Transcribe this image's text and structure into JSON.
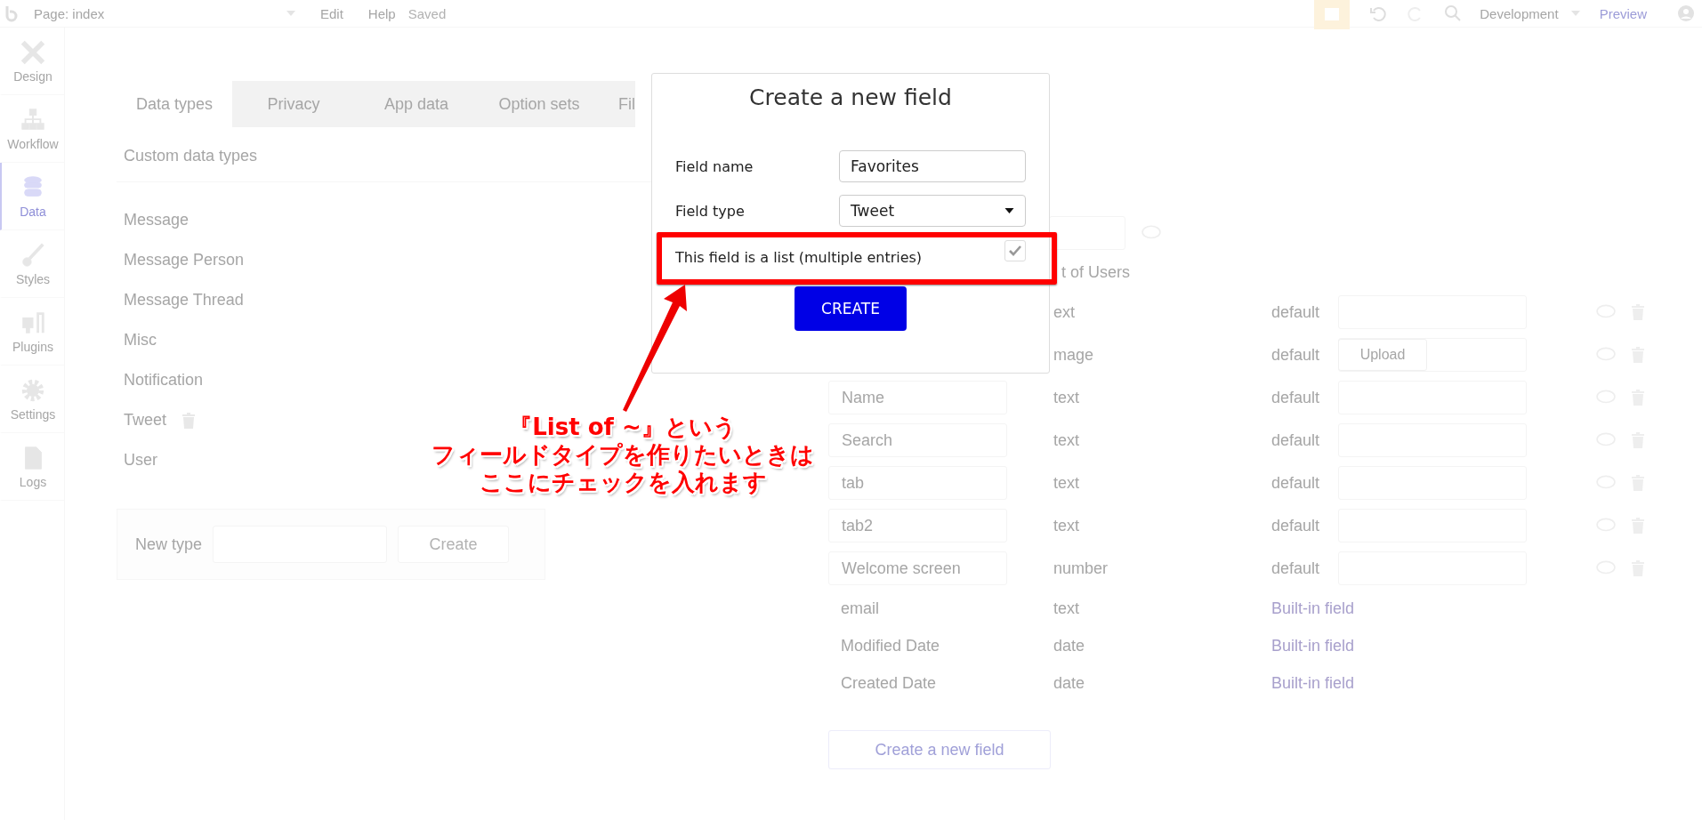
{
  "topbar": {
    "page": "Page: index",
    "menu": [
      "Edit",
      "Help"
    ],
    "status": "Saved",
    "environment": "Development",
    "preview": "Preview"
  },
  "sidebar": [
    {
      "label": "Design",
      "kind": "design",
      "selected": false
    },
    {
      "label": "Workflow",
      "kind": "workflow",
      "selected": false
    },
    {
      "label": "Data",
      "kind": "data",
      "selected": true
    },
    {
      "label": "Styles",
      "kind": "styles",
      "selected": false
    },
    {
      "label": "Plugins",
      "kind": "plugins",
      "selected": false
    },
    {
      "label": "Settings",
      "kind": "settings",
      "selected": false
    },
    {
      "label": "Logs",
      "kind": "logs",
      "selected": false
    }
  ],
  "tabs": [
    {
      "label": "Data types",
      "selected": true
    },
    {
      "label": "Privacy",
      "selected": false
    },
    {
      "label": "App data",
      "selected": false
    },
    {
      "label": "Option sets",
      "selected": false
    },
    {
      "label": "Fil",
      "selected": false
    }
  ],
  "types_title": "Custom data types",
  "types": [
    {
      "name": "Message",
      "hovered": false
    },
    {
      "name": "Message Person",
      "hovered": false
    },
    {
      "name": "Message Thread",
      "hovered": false
    },
    {
      "name": "Misc",
      "hovered": false
    },
    {
      "name": "Notification",
      "hovered": false
    },
    {
      "name": "Tweet",
      "hovered": true
    },
    {
      "name": "User",
      "hovered": false
    }
  ],
  "new_type": {
    "label": "New type",
    "button": "Create"
  },
  "fields_title": "t of Users",
  "fields": [
    {
      "kind": "custom",
      "type": "ext",
      "default": "default"
    },
    {
      "kind": "custom",
      "type": "mage",
      "default": "default",
      "upload": "Upload"
    },
    {
      "kind": "custom",
      "name": "Name",
      "type": "text",
      "default": "default"
    },
    {
      "kind": "custom",
      "name": "Search",
      "type": "text",
      "default": "default"
    },
    {
      "kind": "custom",
      "name": "tab",
      "type": "text",
      "default": "default"
    },
    {
      "kind": "custom",
      "name": "tab2",
      "type": "text",
      "default": "default"
    },
    {
      "kind": "custom",
      "name": "Welcome screen",
      "type": "number",
      "default": "default"
    },
    {
      "kind": "builtin",
      "name": "email",
      "type": "text",
      "note": "Built-in field"
    },
    {
      "kind": "builtin",
      "name": "Modified Date",
      "type": "date",
      "note": "Built-in field"
    },
    {
      "kind": "builtin",
      "name": "Created Date",
      "type": "date",
      "note": "Built-in field"
    }
  ],
  "create_field": "Create a new field",
  "modal": {
    "title": "Create a new field",
    "name_label": "Field name",
    "name_value": "Favorites",
    "type_label": "Field type",
    "type_value": "Tweet",
    "list_label": "This field is a list (multiple entries)",
    "list_checked": true,
    "button": "CREATE"
  },
  "annotation": {
    "lines": [
      "『List of ~』という",
      "フィールドタイプを作りたいときは",
      "ここにチェックを入れます"
    ]
  }
}
